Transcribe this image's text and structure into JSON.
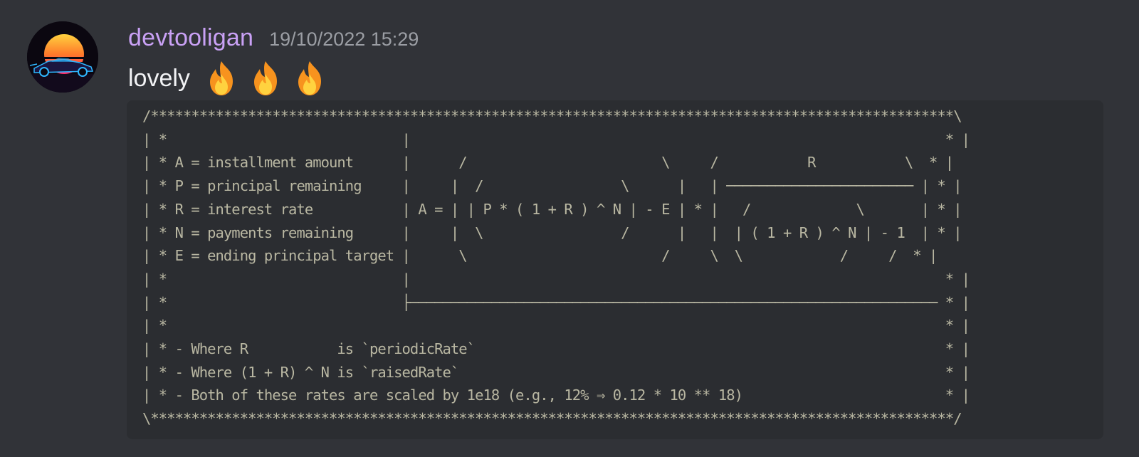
{
  "message": {
    "username": "devtooligan",
    "timestamp": "19/10/2022 15:29",
    "text": "lovely",
    "emojis": [
      "fire-emoji",
      "fire-emoji",
      "fire-emoji"
    ],
    "avatar_icon": "synthwave-car-avatar"
  },
  "code_block": {
    "lines": [
      "/***************************************************************************************************\\",
      "| *                             |                                                                  * |",
      "| * A = installment amount      |      /                        \\     /           R           \\  * |",
      "| * P = principal remaining     |     |  /                 \\      |   | ─────────────────────── | * |",
      "| * R = interest rate           | A = | | P * ( 1 + R ) ^ N | - E | * |   /             \\       | * |",
      "| * N = payments remaining      |     |  \\                 /      |   |  | ( 1 + R ) ^ N | - 1  | * |",
      "| * E = ending principal target |      \\                        /     \\  \\            /     /  * |",
      "| *                             |                                                                  * |",
      "| *                             ├───────────────────────────────────────────────────────────────── * |",
      "| *                                                                                                * |",
      "| * - Where R           is `periodicRate`                                                          * |",
      "| * - Where (1 + R) ^ N is `raisedRate`                                                            * |",
      "| * - Both of these rates are scaled by 1e18 (e.g., 12% ⇒ 0.12 * 10 ** 18)                         * |",
      "\\***************************************************************************************************/"
    ]
  },
  "colors": {
    "background": "#313338",
    "username": "#c9a1f5",
    "timestamp": "#9b9ea4",
    "text": "#f2f3f5",
    "code_background": "#2b2d31",
    "code_text": "#b9b7a2"
  }
}
